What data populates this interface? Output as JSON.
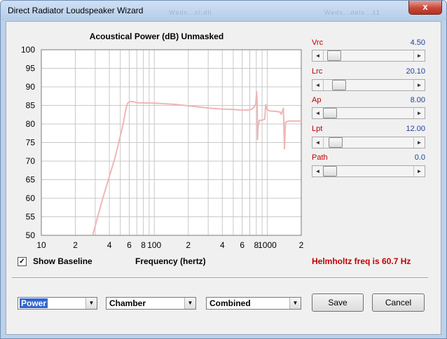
{
  "window": {
    "title": "Direct Radiator Loudspeaker Wizard",
    "ghost_left": "Weds...cl.dll",
    "ghost_right": "Weds...dels...11",
    "close_glyph": "x"
  },
  "chart_data": {
    "type": "line",
    "title": "Acoustical Power (dB)   Unmasked",
    "xlabel": "Frequency (hertz)",
    "ylabel": "",
    "x_scale": "log",
    "xlim": [
      10,
      2000
    ],
    "ylim": [
      50,
      100
    ],
    "yticks": [
      50,
      55,
      60,
      65,
      70,
      75,
      80,
      85,
      90,
      95,
      100
    ],
    "xticks": [
      {
        "v": 10,
        "label": "10"
      },
      {
        "v": 20,
        "label": "2"
      },
      {
        "v": 40,
        "label": "4"
      },
      {
        "v": 60,
        "label": "6"
      },
      {
        "v": 80,
        "label": "8"
      },
      {
        "v": 100,
        "label": "100"
      },
      {
        "v": 200,
        "label": "2"
      },
      {
        "v": 400,
        "label": "4"
      },
      {
        "v": 600,
        "label": "6"
      },
      {
        "v": 800,
        "label": "8"
      },
      {
        "v": 1000,
        "label": "1000"
      },
      {
        "v": 2000,
        "label": "2"
      }
    ],
    "grid": true,
    "line_color": "#f2b5b5",
    "series": [
      {
        "name": "",
        "points": [
          [
            28.5,
            50
          ],
          [
            35,
            60
          ],
          [
            45,
            71
          ],
          [
            53,
            80
          ],
          [
            56,
            84
          ],
          [
            58,
            85.6
          ],
          [
            61,
            86.1
          ],
          [
            65,
            86
          ],
          [
            70,
            85.7
          ],
          [
            100,
            85.6
          ],
          [
            150,
            85.3
          ],
          [
            200,
            84.9
          ],
          [
            300,
            84.3
          ],
          [
            400,
            84.0
          ],
          [
            500,
            83.9
          ],
          [
            600,
            83.7
          ],
          [
            700,
            83.8
          ],
          [
            750,
            84.2
          ],
          [
            790,
            85.3
          ],
          [
            805,
            88.7
          ],
          [
            815,
            86
          ],
          [
            820,
            75.8
          ],
          [
            828,
            79
          ],
          [
            850,
            81
          ],
          [
            900,
            81
          ],
          [
            950,
            81.3
          ],
          [
            970,
            85.2
          ],
          [
            990,
            84
          ],
          [
            1050,
            83.5
          ],
          [
            1200,
            83.4
          ],
          [
            1300,
            83.2
          ],
          [
            1330,
            82.6
          ],
          [
            1390,
            84.2
          ],
          [
            1420,
            73.3
          ],
          [
            1450,
            80.5
          ],
          [
            1550,
            80.8
          ],
          [
            2000,
            80.8
          ]
        ]
      }
    ]
  },
  "sliders": [
    {
      "label": "Vrc",
      "value": "4.50",
      "pos": 0.05
    },
    {
      "label": "Lrc",
      "value": "20.10",
      "pos": 0.12
    },
    {
      "label": "Ap",
      "value": "8.00",
      "pos": 0.0
    },
    {
      "label": "Lpt",
      "value": "12.00",
      "pos": 0.07
    },
    {
      "label": "Path",
      "value": "0.0",
      "pos": 0.0
    }
  ],
  "baseline": {
    "label": "Show Baseline",
    "checked": true,
    "check_glyph": "✓"
  },
  "helmholtz_text": "Helmholtz freq is 60.7 Hz",
  "selects": [
    {
      "value": "Power"
    },
    {
      "value": "Chamber"
    },
    {
      "value": "Combined"
    }
  ],
  "buttons": {
    "save": "Save",
    "cancel": "Cancel"
  },
  "arrows": {
    "left": "◄",
    "right": "►",
    "down": "▼"
  }
}
